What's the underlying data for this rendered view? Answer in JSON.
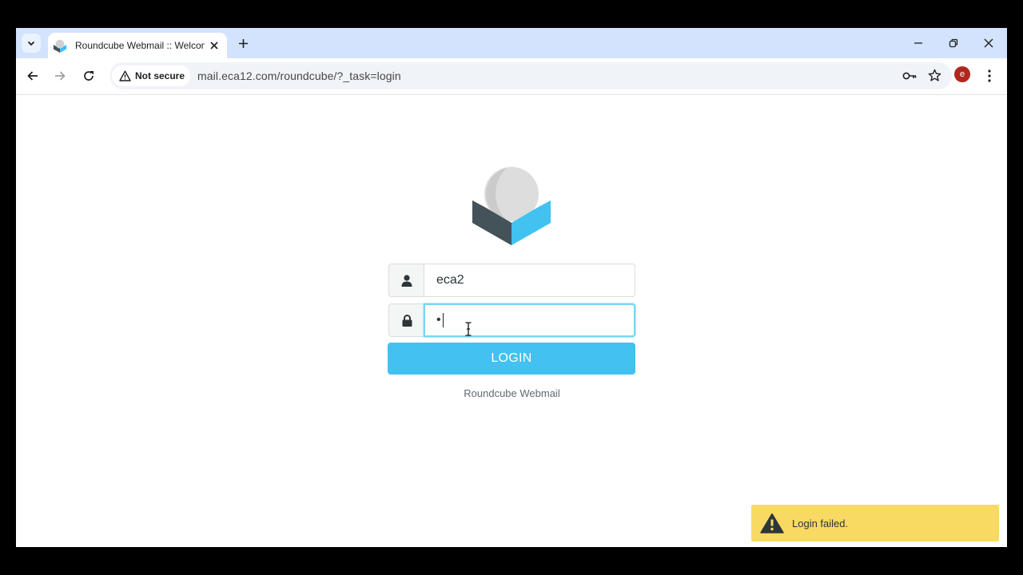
{
  "browser": {
    "tab_title": "Roundcube Webmail :: Welcome",
    "security_label": "Not secure",
    "url": "mail.eca12.com/roundcube/?_task=login",
    "profile_initial": "e"
  },
  "login": {
    "username_value": "eca2",
    "password_mask": "•",
    "login_label": "LOGIN",
    "footer_text": "Roundcube Webmail"
  },
  "notification": {
    "message": "Login failed."
  },
  "colors": {
    "tabstrip": "#d3e3fd",
    "login_button": "#41c2f0",
    "toast": "#f8d962",
    "avatar": "#b3261e"
  }
}
